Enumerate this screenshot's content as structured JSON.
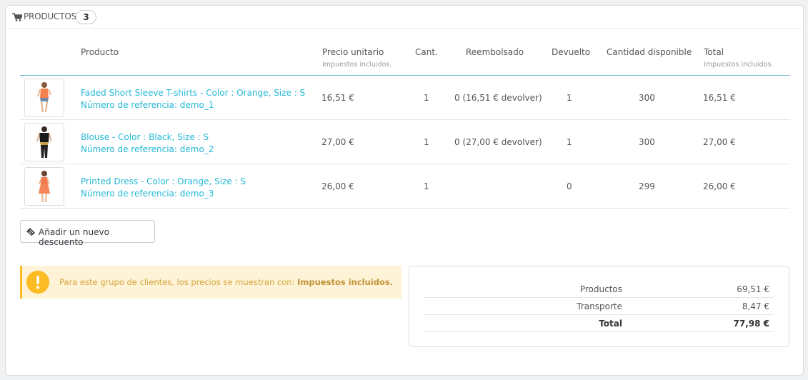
{
  "panel": {
    "title": "Productos",
    "count": "3"
  },
  "columns": {
    "product": "Producto",
    "unit_price": "Precio unitario",
    "unit_price_sub": "Impuestos incluidos.",
    "qty": "Cant.",
    "refunded": "Reembolsado",
    "returned": "Devuelto",
    "available": "Cantidad disponible",
    "total": "Total",
    "total_sub": "Impuestos incluidos."
  },
  "rows": [
    {
      "name": "Faded Short Sleeve T-shirts - Color : Orange, Size : S",
      "ref": "Número de referencia: demo_1",
      "price": "16,51 €",
      "qty": "1",
      "refunded": "0 (16,51 € devolver)",
      "returned": "1",
      "available": "300",
      "total": "16,51 €"
    },
    {
      "name": "Blouse - Color : Black, Size : S",
      "ref": "Número de referencia: demo_2",
      "price": "27,00 €",
      "qty": "1",
      "refunded": "0 (27,00 € devolver)",
      "returned": "1",
      "available": "300",
      "total": "27,00 €"
    },
    {
      "name": "Printed Dress - Color : Orange, Size : S",
      "ref": "Número de referencia: demo_3",
      "price": "26,00 €",
      "qty": "1",
      "refunded": "",
      "returned": "0",
      "available": "299",
      "total": "26,00 €"
    }
  ],
  "discount_button": "Añadir un nuevo descuento",
  "alert": {
    "text": "Para este grupo de clientes, los precios se muestran con:",
    "strong": "Impuestos incluidos."
  },
  "totals": [
    {
      "label": "Productos",
      "value": "69,51 €"
    },
    {
      "label": "Transporte",
      "value": "8,47 €"
    },
    {
      "label": "Total",
      "value": "77,98 €"
    }
  ],
  "icons": {
    "cart": "shopping-cart-icon",
    "tag": "ticket-icon",
    "warning": "warning-icon"
  },
  "colors": {
    "link": "#25b9d7",
    "warning": "#fbbb22",
    "alert_bg": "#fff3d7"
  }
}
